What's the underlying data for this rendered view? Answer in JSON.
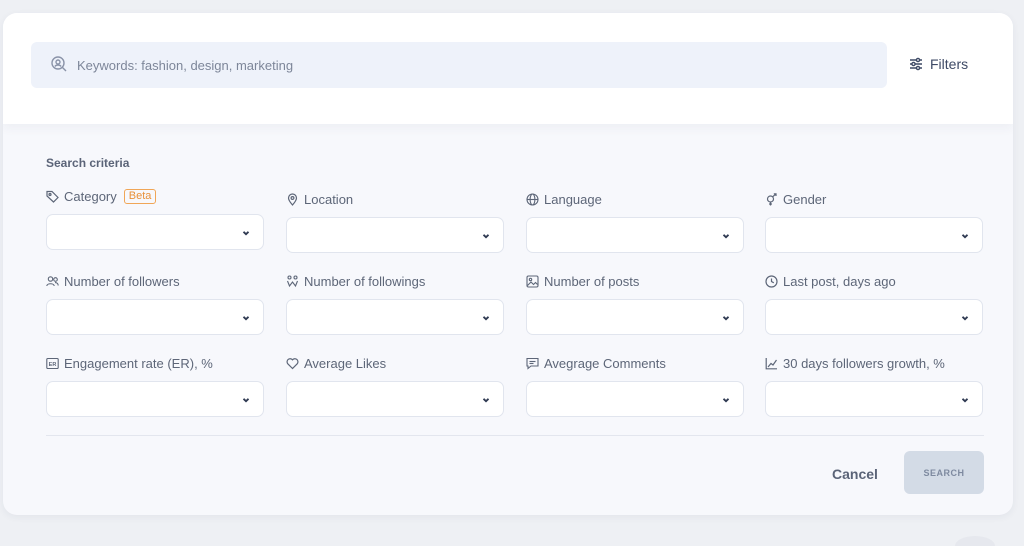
{
  "search": {
    "placeholder": "Keywords: fashion, design, marketing",
    "value": ""
  },
  "filters_label": "Filters",
  "section_title": "Search criteria",
  "fields": [
    {
      "label": "Category",
      "badge": "Beta",
      "icon": "tag-icon",
      "value": ""
    },
    {
      "label": "Location",
      "icon": "location-pin-icon",
      "value": ""
    },
    {
      "label": "Language",
      "icon": "globe-icon",
      "value": ""
    },
    {
      "label": "Gender",
      "icon": "gender-icon",
      "value": ""
    },
    {
      "label": "Number of followers",
      "icon": "users-icon",
      "value": ""
    },
    {
      "label": "Number of followings",
      "icon": "followings-icon",
      "value": ""
    },
    {
      "label": "Number of posts",
      "icon": "image-icon",
      "value": ""
    },
    {
      "label": "Last post, days ago",
      "icon": "clock-icon",
      "value": ""
    },
    {
      "label": "Engagement rate (ER), %",
      "icon": "er-icon",
      "value": ""
    },
    {
      "label": "Average Likes",
      "icon": "heart-icon",
      "value": ""
    },
    {
      "label": "Avegrage Comments",
      "icon": "comment-icon",
      "value": ""
    },
    {
      "label": "30 days followers growth, %",
      "icon": "growth-chart-icon",
      "value": ""
    }
  ],
  "actions": {
    "cancel": "Cancel",
    "search": "SEARCH"
  },
  "colors": {
    "accent_badge": "#f0a657",
    "search_button_bg": "#d3dbe6",
    "input_bg": "#eef2fa"
  }
}
